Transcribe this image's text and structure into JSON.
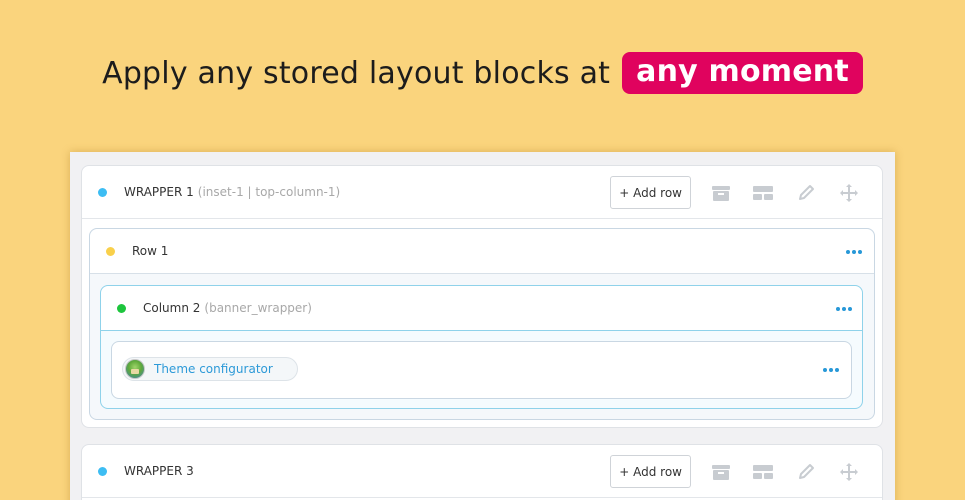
{
  "headline": {
    "text": "Apply any stored layout blocks at",
    "highlight": "any moment"
  },
  "colors": {
    "background": "#fad47d",
    "highlight": "#e0035e",
    "wrapper_dot": "#3dbdf3",
    "row_dot": "#f9d04b",
    "column_dot": "#1dc53d",
    "link": "#2d9ad8"
  },
  "wrapper1": {
    "title": "WRAPPER 1",
    "subtitle": "(inset-1 | top-column-1)",
    "add_row_label": "+ Add row",
    "tools": [
      "archive-icon",
      "layout-icon",
      "pencil-icon",
      "move-icon"
    ],
    "row": {
      "title": "Row 1",
      "column": {
        "title": "Column 2",
        "subtitle": "(banner_wrapper)",
        "module": {
          "label": "Theme configurator",
          "icon": "theme-configurator-icon"
        }
      }
    }
  },
  "wrapper3": {
    "title": "WRAPPER 3",
    "add_row_label": "+ Add row",
    "tools": [
      "archive-icon",
      "layout-icon",
      "pencil-icon",
      "move-icon"
    ]
  }
}
